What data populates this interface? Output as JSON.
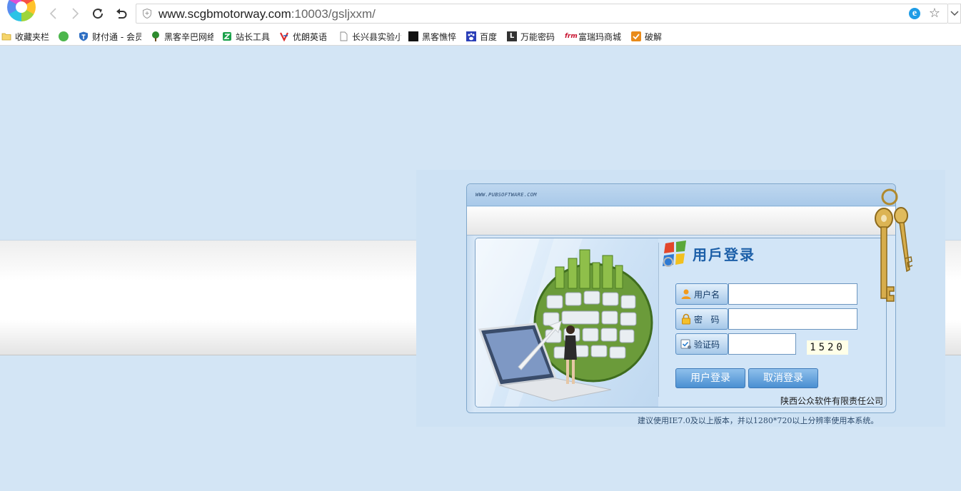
{
  "browser": {
    "url_host": "www.scgbmotorway.com",
    "url_rest": ":10003/gsljxxm/",
    "icons": {
      "back": "back-arrow-icon",
      "forward": "forward-arrow-icon",
      "reload": "reload-icon",
      "undo": "undo-icon",
      "shield": "shield-icon",
      "ie_mode": "ie-mode-icon",
      "favorite": "star-icon",
      "dropdown": "chevron-down-icon"
    }
  },
  "bookmarks": {
    "favorites_label": "收藏夹栏",
    "items": [
      {
        "label": "",
        "icon": "360-green-e-icon"
      },
      {
        "label": "财付通 - 会员",
        "icon": "shield-blue-icon"
      },
      {
        "label": "黑客辛巴网络",
        "icon": "tree-icon"
      },
      {
        "label": "站长工具",
        "icon": "chinaz-icon"
      },
      {
        "label": "优朗英语",
        "icon": "youlang-icon"
      },
      {
        "label": "长兴县实验小",
        "icon": "page-icon"
      },
      {
        "label": "黑客憔悴",
        "icon": "black-square-icon"
      },
      {
        "label": "百度",
        "icon": "baidu-paw-icon"
      },
      {
        "label": "万能密码",
        "icon": "letter-l-icon"
      },
      {
        "label": "富瑞玛商城",
        "icon": "frm-icon"
      },
      {
        "label": "破解",
        "icon": "orange-check-icon"
      }
    ]
  },
  "login": {
    "header_site": "WWW.PUBSOFTWARE.COM",
    "title": "用戶登录",
    "fields": {
      "username_label": "用户名",
      "password_label": "密   码",
      "captcha_label": "验证码",
      "username_value": "",
      "password_value": "",
      "captcha_value": ""
    },
    "captcha_code": "1520",
    "buttons": {
      "login": "用户登录",
      "cancel": "取消登录"
    },
    "company": "陕西公众软件有限责任公司",
    "notice": "建议使用IE7.0及以上版本，并以1280*720以上分辨率使用本系统。"
  },
  "colors": {
    "page_bg": "#d3e5f5",
    "accent": "#1c5fa8",
    "button": "#4a8fd2"
  }
}
